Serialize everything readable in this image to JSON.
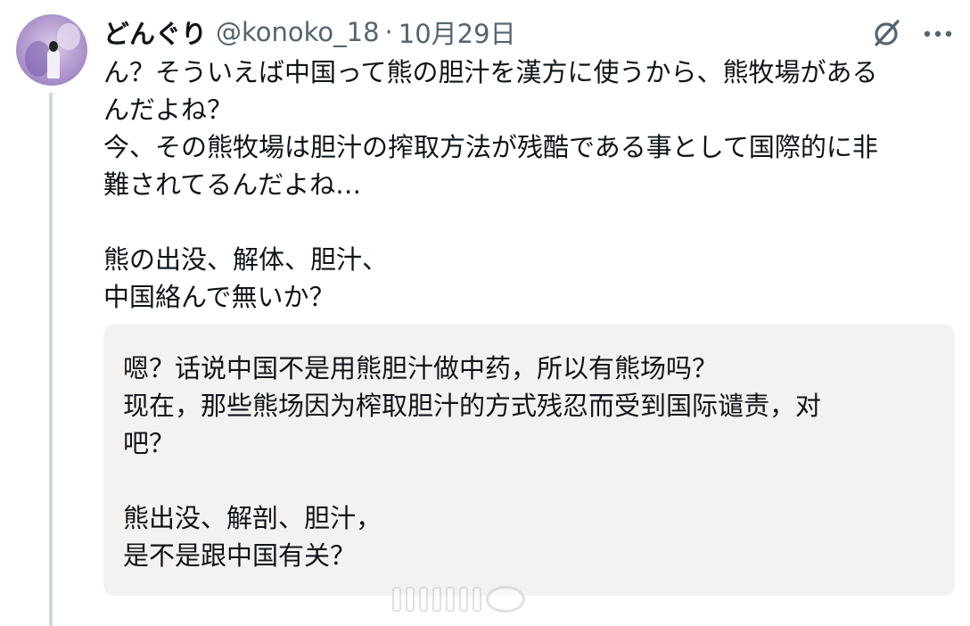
{
  "tweet": {
    "author": {
      "display_name": "どんぐり",
      "handle": "@konoko_18"
    },
    "separator": "·",
    "date": "10月29日",
    "body_lines": [
      "ん？そういえば中国って熊の胆汁を漢方に使うから、熊牧場がある",
      "んだよね？",
      "今、その熊牧場は胆汁の搾取方法が残酷である事として国際的に非",
      "難されてるんだよね…",
      "",
      "熊の出没、解体、胆汁、",
      "中国絡んで無いか？"
    ],
    "translation_lines": [
      "嗯？话说中国不是用熊胆汁做中药，所以有熊场吗？",
      "现在，那些熊场因为榨取胆汁的方式残忍而受到国际谴责，对",
      "吧？",
      "",
      "熊出没、解剖、胆汁，",
      "是不是跟中国有关？"
    ],
    "icons": {
      "grok": "grok-icon",
      "more": "more-options-icon",
      "avatar": "profile-avatar"
    },
    "colors": {
      "text": "#0f1419",
      "secondary_text": "#536471",
      "thread_line": "#cfd9de",
      "translation_bg": "#f4f2f1"
    }
  }
}
